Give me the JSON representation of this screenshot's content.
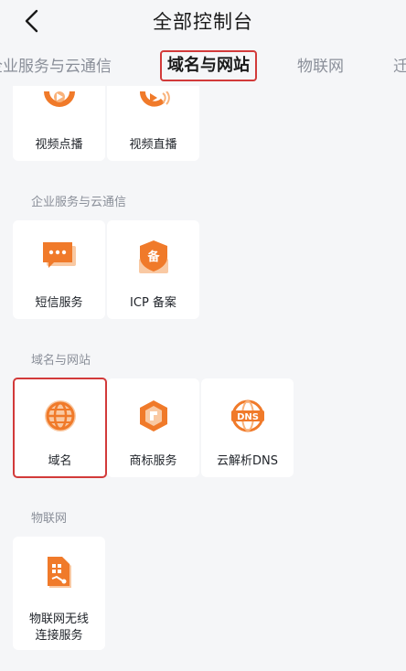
{
  "header": {
    "title": "全部控制台",
    "back_icon": "chevron-left-icon"
  },
  "tabs": [
    {
      "label": "企业服务与云通信",
      "active": false
    },
    {
      "label": "域名与网站",
      "active": true
    },
    {
      "label": "物联网",
      "active": false
    },
    {
      "label": "迁",
      "active": false
    }
  ],
  "sections": {
    "video": {
      "items": [
        {
          "label": "视频点播",
          "icon": "video-on-demand-icon"
        },
        {
          "label": "视频直播",
          "icon": "live-streaming-icon"
        }
      ]
    },
    "enterprise": {
      "title": "企业服务与云通信",
      "items": [
        {
          "label": "短信服务",
          "icon": "sms-icon"
        },
        {
          "label": "ICP 备案",
          "icon": "icp-filing-icon"
        }
      ]
    },
    "domain": {
      "title": "域名与网站",
      "items": [
        {
          "label": "域名",
          "icon": "globe-icon"
        },
        {
          "label": "商标服务",
          "icon": "trademark-icon"
        },
        {
          "label": "云解析DNS",
          "icon": "dns-icon"
        }
      ]
    },
    "iot": {
      "title": "物联网",
      "items": [
        {
          "label_line1": "物联网无线",
          "label_line2": "连接服务",
          "icon": "iot-sim-icon"
        }
      ]
    }
  },
  "colors": {
    "accent_orange": "#f07a2a",
    "highlight_red": "#d23a3a",
    "background": "#f5f6f8"
  }
}
